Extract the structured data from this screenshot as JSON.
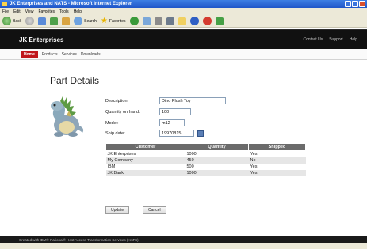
{
  "window": {
    "title": "JK Enterprises and NATS - Microsoft Internet Explorer"
  },
  "menu": [
    "File",
    "Edit",
    "View",
    "Favorites",
    "Tools",
    "Help"
  ],
  "toolbar": {
    "back_label": "Back",
    "search_label": "Search",
    "favorites_label": "Favorites"
  },
  "site": {
    "name": "JK Enterprises",
    "top_links": [
      "Contact Us",
      "Support",
      "Help"
    ]
  },
  "nav": {
    "home": "Home",
    "items": [
      "Products",
      "Services",
      "Downloads"
    ]
  },
  "page": {
    "title": "Part Details"
  },
  "form": {
    "description": {
      "label": "Description:",
      "value": "Dino Plush Toy"
    },
    "quantity": {
      "label": "Quantity on hand:",
      "value": "100"
    },
    "model": {
      "label": "Model:",
      "value": "m12"
    },
    "ship_date": {
      "label": "Ship date:",
      "value": "19970815"
    }
  },
  "table": {
    "headers": [
      "Customer",
      "Quantity",
      "Shipped"
    ],
    "rows": [
      [
        "JK Enterprises",
        "1000",
        "Yes"
      ],
      [
        "My Company",
        "450",
        "No"
      ],
      [
        "IBM",
        "500",
        "Yes"
      ],
      [
        "JK Bank",
        "1000",
        "Yes"
      ]
    ]
  },
  "buttons": {
    "update": "Update",
    "cancel": "Cancel"
  },
  "footer": {
    "text": "Created with IBM® Rational® Host Access Transformation Services (HATS)"
  },
  "colors": {
    "header_bg": "#111111",
    "home_tab": "#c0171c",
    "table_header": "#6b6b6b"
  }
}
